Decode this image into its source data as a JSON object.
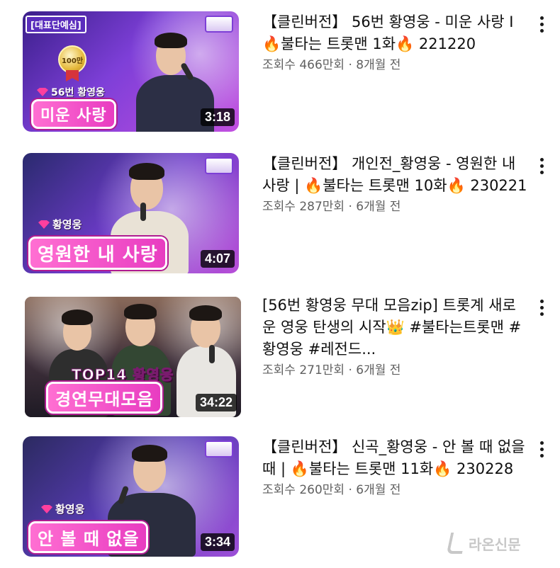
{
  "videos": [
    {
      "title": "【클린버전】 56번 황영웅 - 미운 사랑 I 🔥불타는 트롯맨 1화🔥 221220",
      "meta": "조회수 466만회 · 8개월 전",
      "duration": "3:18",
      "thumb_caption": "미운 사랑",
      "thumb_name": "56번 황영웅",
      "thumb_tag": "[대표단예심]",
      "thumb_badge": "100만"
    },
    {
      "title": "【클린버전】 개인전_황영웅 - 영원한 내 사랑  | 🔥불타는 트롯맨 10화🔥 230221",
      "meta": "조회수 287만회 · 6개월 전",
      "duration": "4:07",
      "thumb_caption": "영원한 내 사랑",
      "thumb_name": "황영웅"
    },
    {
      "title": "[56번 황영웅 무대 모음zip] 트롯계 새로운 영웅 탄생의 시작👑 #불타는트롯맨 #황영웅 #레전드...",
      "meta": "조회수 271만회 · 6개월 전",
      "duration": "34:22",
      "thumb_caption": "경연무대모음",
      "thumb_name": "TOP14 황영웅"
    },
    {
      "title": "【클린버전】 신곡_황영웅 - 안 볼 때 없을 때  | 🔥불타는 트롯맨 11화🔥 230228",
      "meta": "조회수 260만회 · 6개월 전",
      "duration": "3:34",
      "thumb_caption": "안 볼 때 없을",
      "thumb_name": "황영웅"
    }
  ],
  "watermark": "라온신문",
  "colors": {
    "title_text": "#0f0f0f",
    "meta_text": "#606060",
    "thumb_pink": "#e83cc1",
    "thumb_purple": "#6a2fc0"
  },
  "icons": {
    "kebab": "more-vert-icon"
  }
}
